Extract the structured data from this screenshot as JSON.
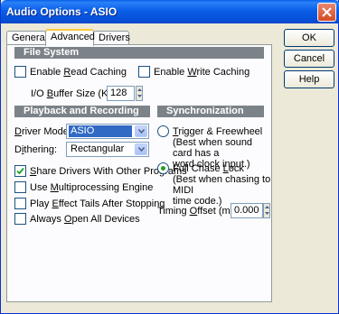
{
  "window": {
    "title": "Audio Options - ASIO"
  },
  "tabs": [
    {
      "label": "General"
    },
    {
      "label": "Advanced"
    },
    {
      "label": "Drivers"
    }
  ],
  "file_system": {
    "header": "File System",
    "enable_read_caching": {
      "pre": "Enable ",
      "key": "R",
      "post": "ead Caching",
      "checked": false
    },
    "enable_write_caching": {
      "pre": "Enable ",
      "key": "W",
      "post": "rite Caching",
      "checked": false
    },
    "io_buffer": {
      "pre": "I/O ",
      "key": "B",
      "post": "uffer Size (KB):",
      "value": "128"
    }
  },
  "playback": {
    "header": "Playback and Recording",
    "driver_mode": {
      "key": "D",
      "post": "river Mode:",
      "value": "ASIO"
    },
    "dithering": {
      "pre": "D",
      "key": "i",
      "post": "thering:",
      "value": "Rectangular"
    },
    "share_drivers": {
      "key": "S",
      "post": "hare Drivers With Other Programs",
      "checked": true
    },
    "multiprocessing": {
      "pre": "Use ",
      "key": "M",
      "post": "ultiprocessing Engine",
      "checked": false
    },
    "effect_tails": {
      "pre": "Play ",
      "key": "E",
      "post": "ffect Tails After Stopping",
      "checked": false
    },
    "open_devices": {
      "pre": "Always ",
      "key": "O",
      "post": "pen All Devices",
      "checked": false
    }
  },
  "sync": {
    "header": "Synchronization",
    "trigger": {
      "key": "T",
      "post": "rigger & Freewheel",
      "desc1": "(Best when sound card has a",
      "desc2": "word clock input.)",
      "selected": false
    },
    "full_chase": {
      "pre": "Full Chase ",
      "key": "L",
      "post": "ock",
      "desc1": "(Best when chasing to MIDI",
      "desc2": "time code.)",
      "selected": true
    },
    "timing_offset": {
      "pre": "Timing ",
      "key": "O",
      "post": "ffset (msec):",
      "value": "0.000"
    }
  },
  "buttons": {
    "ok": "OK",
    "cancel": "Cancel",
    "help": "Help"
  }
}
